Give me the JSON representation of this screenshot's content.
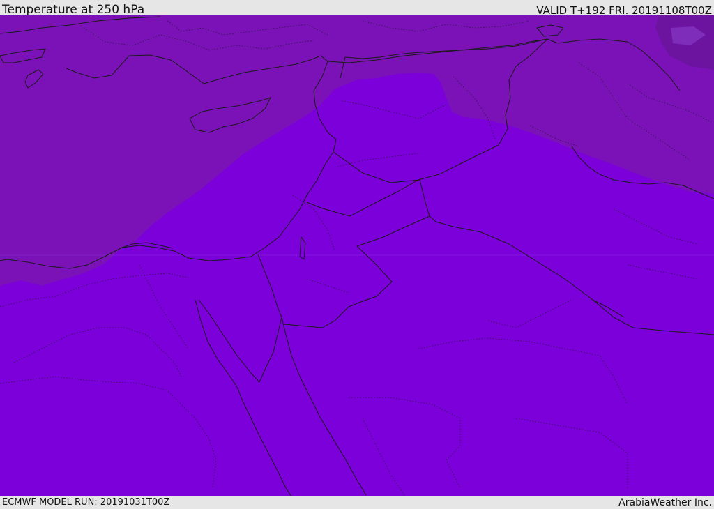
{
  "header": {
    "title": "Temperature at 250 hPa",
    "valid": "VALID T+192 FRI. 20191108T00Z"
  },
  "footer": {
    "model_run": "ECMWF MODEL RUN: 20191031T00Z",
    "credit": "ArabiaWeather Inc."
  },
  "map": {
    "colors": {
      "warmer_band": "#7a12b8",
      "colder_band": "#7c00da",
      "darkest_patch": "#6c14a0",
      "coastline": "#1a1a1a"
    }
  }
}
